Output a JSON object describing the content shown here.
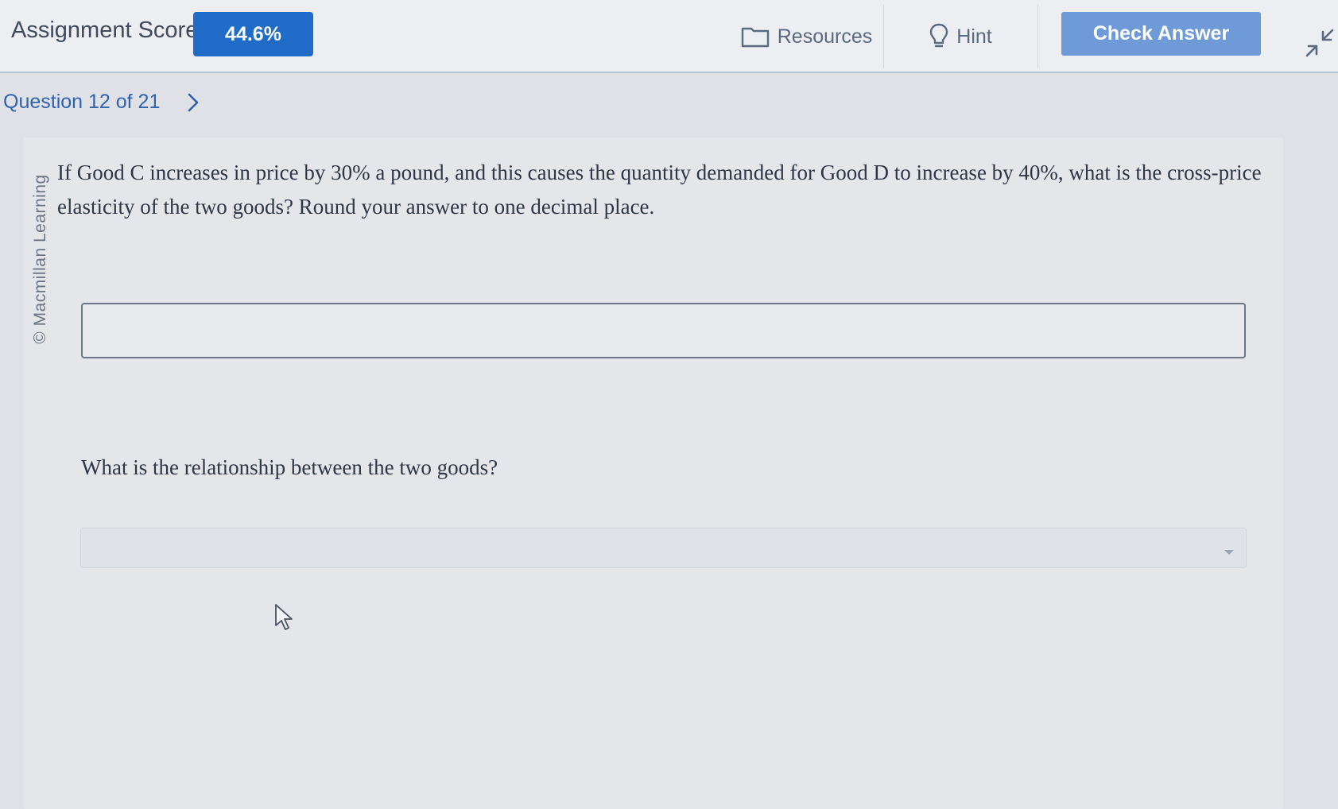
{
  "toolbar": {
    "score_label": "Assignment Score:",
    "score_value": "44.6%",
    "resources_label": "Resources",
    "hint_label": "Hint",
    "check_answer_label": "Check Answer"
  },
  "question_nav": {
    "label": "Question 12 of 21"
  },
  "question": {
    "watermark": "© Macmillan Learning",
    "text": "If Good C increases in price by 30% a pound, and this causes the quantity demanded for Good D to increase by 40%, what is the cross-price elasticity of the two goods? Round your answer to one decimal place.",
    "answer_value": "",
    "relationship_prompt": "What is the relationship between the two goods?",
    "relationship_selected": ""
  },
  "colors": {
    "accent_blue": "#1f6bc7",
    "check_button": "#6f9ad8",
    "link_blue": "#2f63b0"
  },
  "icons": {
    "resources": "folder-icon",
    "hint": "lightbulb-icon",
    "next": "chevron-right-icon",
    "collapse": "collapse-arrows-icon",
    "dropdown": "caret-down-icon",
    "cursor": "mouse-pointer-icon"
  }
}
